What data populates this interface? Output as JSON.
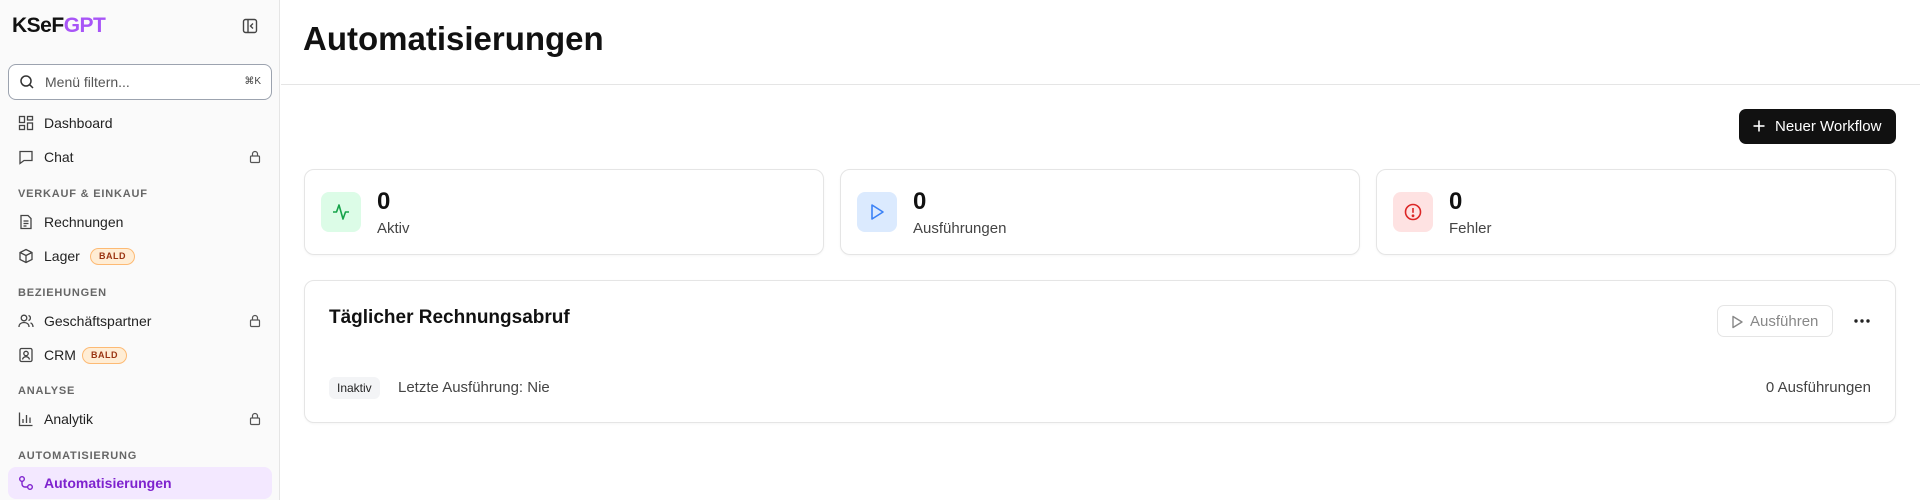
{
  "brand": {
    "part1": "KSeF",
    "part2": "GPT"
  },
  "search": {
    "placeholder": "Menü filtern...",
    "shortcut": "⌘K"
  },
  "nav": {
    "dashboard": "Dashboard",
    "chat": "Chat",
    "section_sales": "VERKAUF & EINKAUF",
    "invoices": "Rechnungen",
    "warehouse": "Lager",
    "section_relations": "BEZIEHUNGEN",
    "partners": "Geschäftspartner",
    "crm": "CRM",
    "section_analysis": "ANALYSE",
    "analytics": "Analytik",
    "section_automation": "AUTOMATISIERUNG",
    "automations": "Automatisierungen",
    "soon_badge": "BALD"
  },
  "header": {
    "title": "Automatisierungen"
  },
  "toolbar": {
    "new_workflow_label": "Neuer Workflow"
  },
  "stats": [
    {
      "value": "0",
      "label": "Aktiv",
      "color": "#16a34a"
    },
    {
      "value": "0",
      "label": "Ausführungen",
      "color": "#3b82f6"
    },
    {
      "value": "0",
      "label": "Fehler",
      "color": "#dc2626"
    }
  ],
  "workflow": {
    "title": "Täglicher Rechnungsabruf",
    "run_label": "Ausführen",
    "status": "Inaktiv",
    "last_run": "Letzte Ausführung: Nie",
    "run_count": "0 Ausführungen"
  },
  "colors": {
    "accent": "#7e22ce",
    "brand_accent": "#a855f7"
  }
}
